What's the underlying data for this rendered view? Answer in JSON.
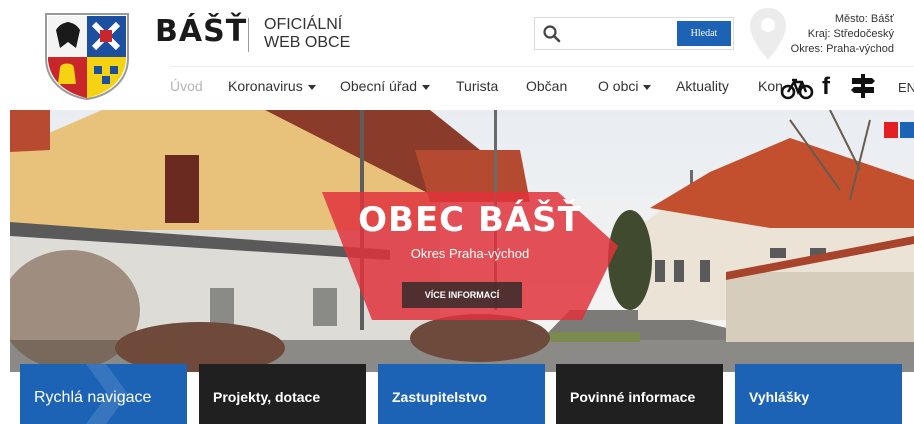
{
  "brand": {
    "title": "BÁŠŤ",
    "subtitle_line1": "OFICIÁLNÍ",
    "subtitle_line2": "WEB OBCE"
  },
  "search": {
    "placeholder": "",
    "button_label": "Hledat"
  },
  "region": {
    "city": "Město: Bášť",
    "region": "Kraj: Středočeský",
    "district": "Okres: Praha-východ"
  },
  "nav": {
    "items": [
      {
        "label": "Úvod",
        "active": true,
        "dropdown": false
      },
      {
        "label": "Koronavirus",
        "active": false,
        "dropdown": true
      },
      {
        "label": "Obecní úřad",
        "active": false,
        "dropdown": true
      },
      {
        "label": "Turista",
        "active": false,
        "dropdown": false
      },
      {
        "label": "Občan",
        "active": false,
        "dropdown": false
      },
      {
        "label": "O obci",
        "active": false,
        "dropdown": true
      },
      {
        "label": "Aktuality",
        "active": false,
        "dropdown": false
      },
      {
        "label": "Kontakty",
        "active": false,
        "dropdown": false
      }
    ],
    "language": "EN"
  },
  "hero": {
    "title": "OBEC BÁŠŤ",
    "subtitle": "Okres Praha-východ",
    "button_label": "VÍCE INFORMACÍ"
  },
  "tiles": [
    {
      "label": "Rychlá navigace",
      "style": "blue"
    },
    {
      "label": "Projekty, dotace",
      "style": "dark"
    },
    {
      "label": "Zastupitelstvo",
      "style": "blue"
    },
    {
      "label": "Povinné informace",
      "style": "dark"
    },
    {
      "label": "Vyhlášky",
      "style": "blue"
    }
  ],
  "icons": {
    "crest": "coat-of-arms-icon",
    "search": "search-icon",
    "pin": "map-pin-icon",
    "bike": "bicycle-icon",
    "facebook": "facebook-icon",
    "signpost": "signpost-icon"
  },
  "colors": {
    "brand_blue": "#1c63b6",
    "dark_tile": "#202020",
    "banner_red": "#e0323c",
    "slider_dot_red": "#e31e24",
    "slider_dot_blue": "#1c63b6"
  }
}
